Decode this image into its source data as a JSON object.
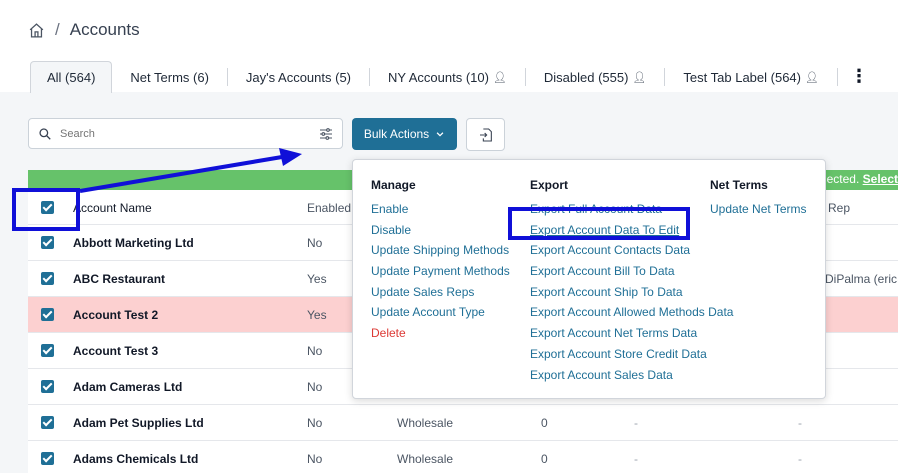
{
  "breadcrumb": {
    "title": "Accounts"
  },
  "tabs": [
    {
      "label": "All (564)",
      "shared": false
    },
    {
      "label": "Net Terms (6)",
      "shared": false
    },
    {
      "label": "Jay's Accounts (5)",
      "shared": false
    },
    {
      "label": "NY Accounts (10)",
      "shared": true
    },
    {
      "label": "Disabled (555)",
      "shared": true
    },
    {
      "label": "Test Tab Label (564)",
      "shared": true
    }
  ],
  "search": {
    "placeholder": "Search"
  },
  "bulk_actions": {
    "label": "Bulk Actions"
  },
  "selection_banner": {
    "text": "ected. ",
    "link": "Select"
  },
  "table": {
    "headers": {
      "name": "Account Name",
      "enabled": "Enabled",
      "rep": "Rep"
    },
    "rows": [
      {
        "name": "Abbott Marketing Ltd",
        "enabled": "No",
        "type": "",
        "num": "",
        "dash": "",
        "rep": ""
      },
      {
        "name": "ABC Restaurant",
        "enabled": "Yes",
        "type": "",
        "num": "",
        "dash": "",
        "rep": "DiPalma (eric@"
      },
      {
        "name": "Account Test 2",
        "enabled": "Yes",
        "type": "",
        "num": "",
        "dash": "",
        "rep": ""
      },
      {
        "name": "Account Test 3",
        "enabled": "No",
        "type": "",
        "num": "",
        "dash": "",
        "rep": ""
      },
      {
        "name": "Adam Cameras Ltd",
        "enabled": "No",
        "type": "",
        "num": "",
        "dash": "",
        "rep": ""
      },
      {
        "name": "Adam Pet Supplies Ltd",
        "enabled": "No",
        "type": "Wholesale",
        "num": "0",
        "dash": "-",
        "rep": "-"
      },
      {
        "name": "Adams Chemicals Ltd",
        "enabled": "No",
        "type": "Wholesale",
        "num": "0",
        "dash": "-",
        "rep": "-"
      }
    ]
  },
  "menu": {
    "manage": {
      "heading": "Manage",
      "items": [
        "Enable",
        "Disable",
        "Update Shipping Methods",
        "Update Payment Methods",
        "Update Sales Reps",
        "Update Account Type",
        "Delete"
      ]
    },
    "export": {
      "heading": "Export",
      "items": [
        "Export Full Account Data",
        "Export Account Data To Edit",
        "Export Account Contacts Data",
        "Export Account Bill To Data",
        "Export Account Ship To Data",
        "Export Account Allowed Methods Data",
        "Export Account Net Terms Data",
        "Export Account Store Credit Data",
        "Export Account Sales Data"
      ]
    },
    "net_terms": {
      "heading": "Net Terms",
      "items": [
        "Update Net Terms"
      ]
    }
  },
  "colors": {
    "primary": "#1f6f96",
    "danger": "#dc3a35",
    "annotation": "#1010d8",
    "banner": "#66c26a",
    "highlight_row": "#fcd0d0"
  }
}
